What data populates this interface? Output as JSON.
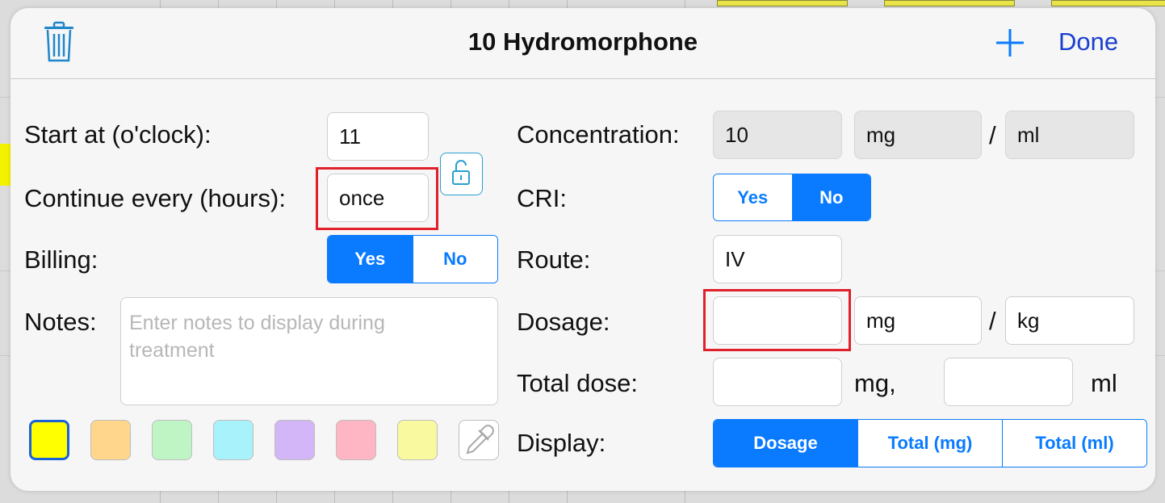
{
  "modal": {
    "title": "10 Hydromorphone",
    "done_label": "Done",
    "plus_icon": "plus-icon",
    "trash_icon": "trash-icon"
  },
  "left": {
    "start_label": "Start at (o'clock):",
    "start_value": "11",
    "continue_label": "Continue every (hours):",
    "continue_value": "once",
    "lock_icon": "unlock-icon",
    "billing_label": "Billing:",
    "billing_options": [
      "Yes",
      "No"
    ],
    "billing_selected": "Yes",
    "notes_label": "Notes:",
    "notes_placeholder": "Enter notes to display during treatment",
    "notes_placeholder_line1": "Enter notes to display during",
    "notes_placeholder_line2": "treatment",
    "swatches": [
      "#ffff00",
      "#ffd68c",
      "#bff5c4",
      "#a8f2fb",
      "#d2b6f8",
      "#ffb6c4",
      "#f9f9a0"
    ],
    "selected_swatch": "#ffff00",
    "eyedropper_icon": "eyedropper-icon"
  },
  "right": {
    "concentration_label": "Concentration:",
    "concentration_value": "10",
    "concentration_unit1": "mg",
    "concentration_slash": "/",
    "concentration_unit2": "ml",
    "cri_label": "CRI:",
    "cri_options": [
      "Yes",
      "No"
    ],
    "cri_selected": "No",
    "route_label": "Route:",
    "route_value": "IV",
    "dosage_label": "Dosage:",
    "dosage_value": "",
    "dosage_unit1": "mg",
    "dosage_slash": "/",
    "dosage_unit2": "kg",
    "total_label": "Total dose:",
    "total_mg_value": "",
    "total_mg_unit": "mg,",
    "total_ml_value": "",
    "total_ml_unit": "ml",
    "display_label": "Display:",
    "display_options": [
      "Dosage",
      "Total (mg)",
      "Total (ml)"
    ],
    "display_selected": "Dosage"
  },
  "colors": {
    "accent": "#0a7bff",
    "done": "#1a3fd0",
    "highlight": "#e0202a"
  }
}
